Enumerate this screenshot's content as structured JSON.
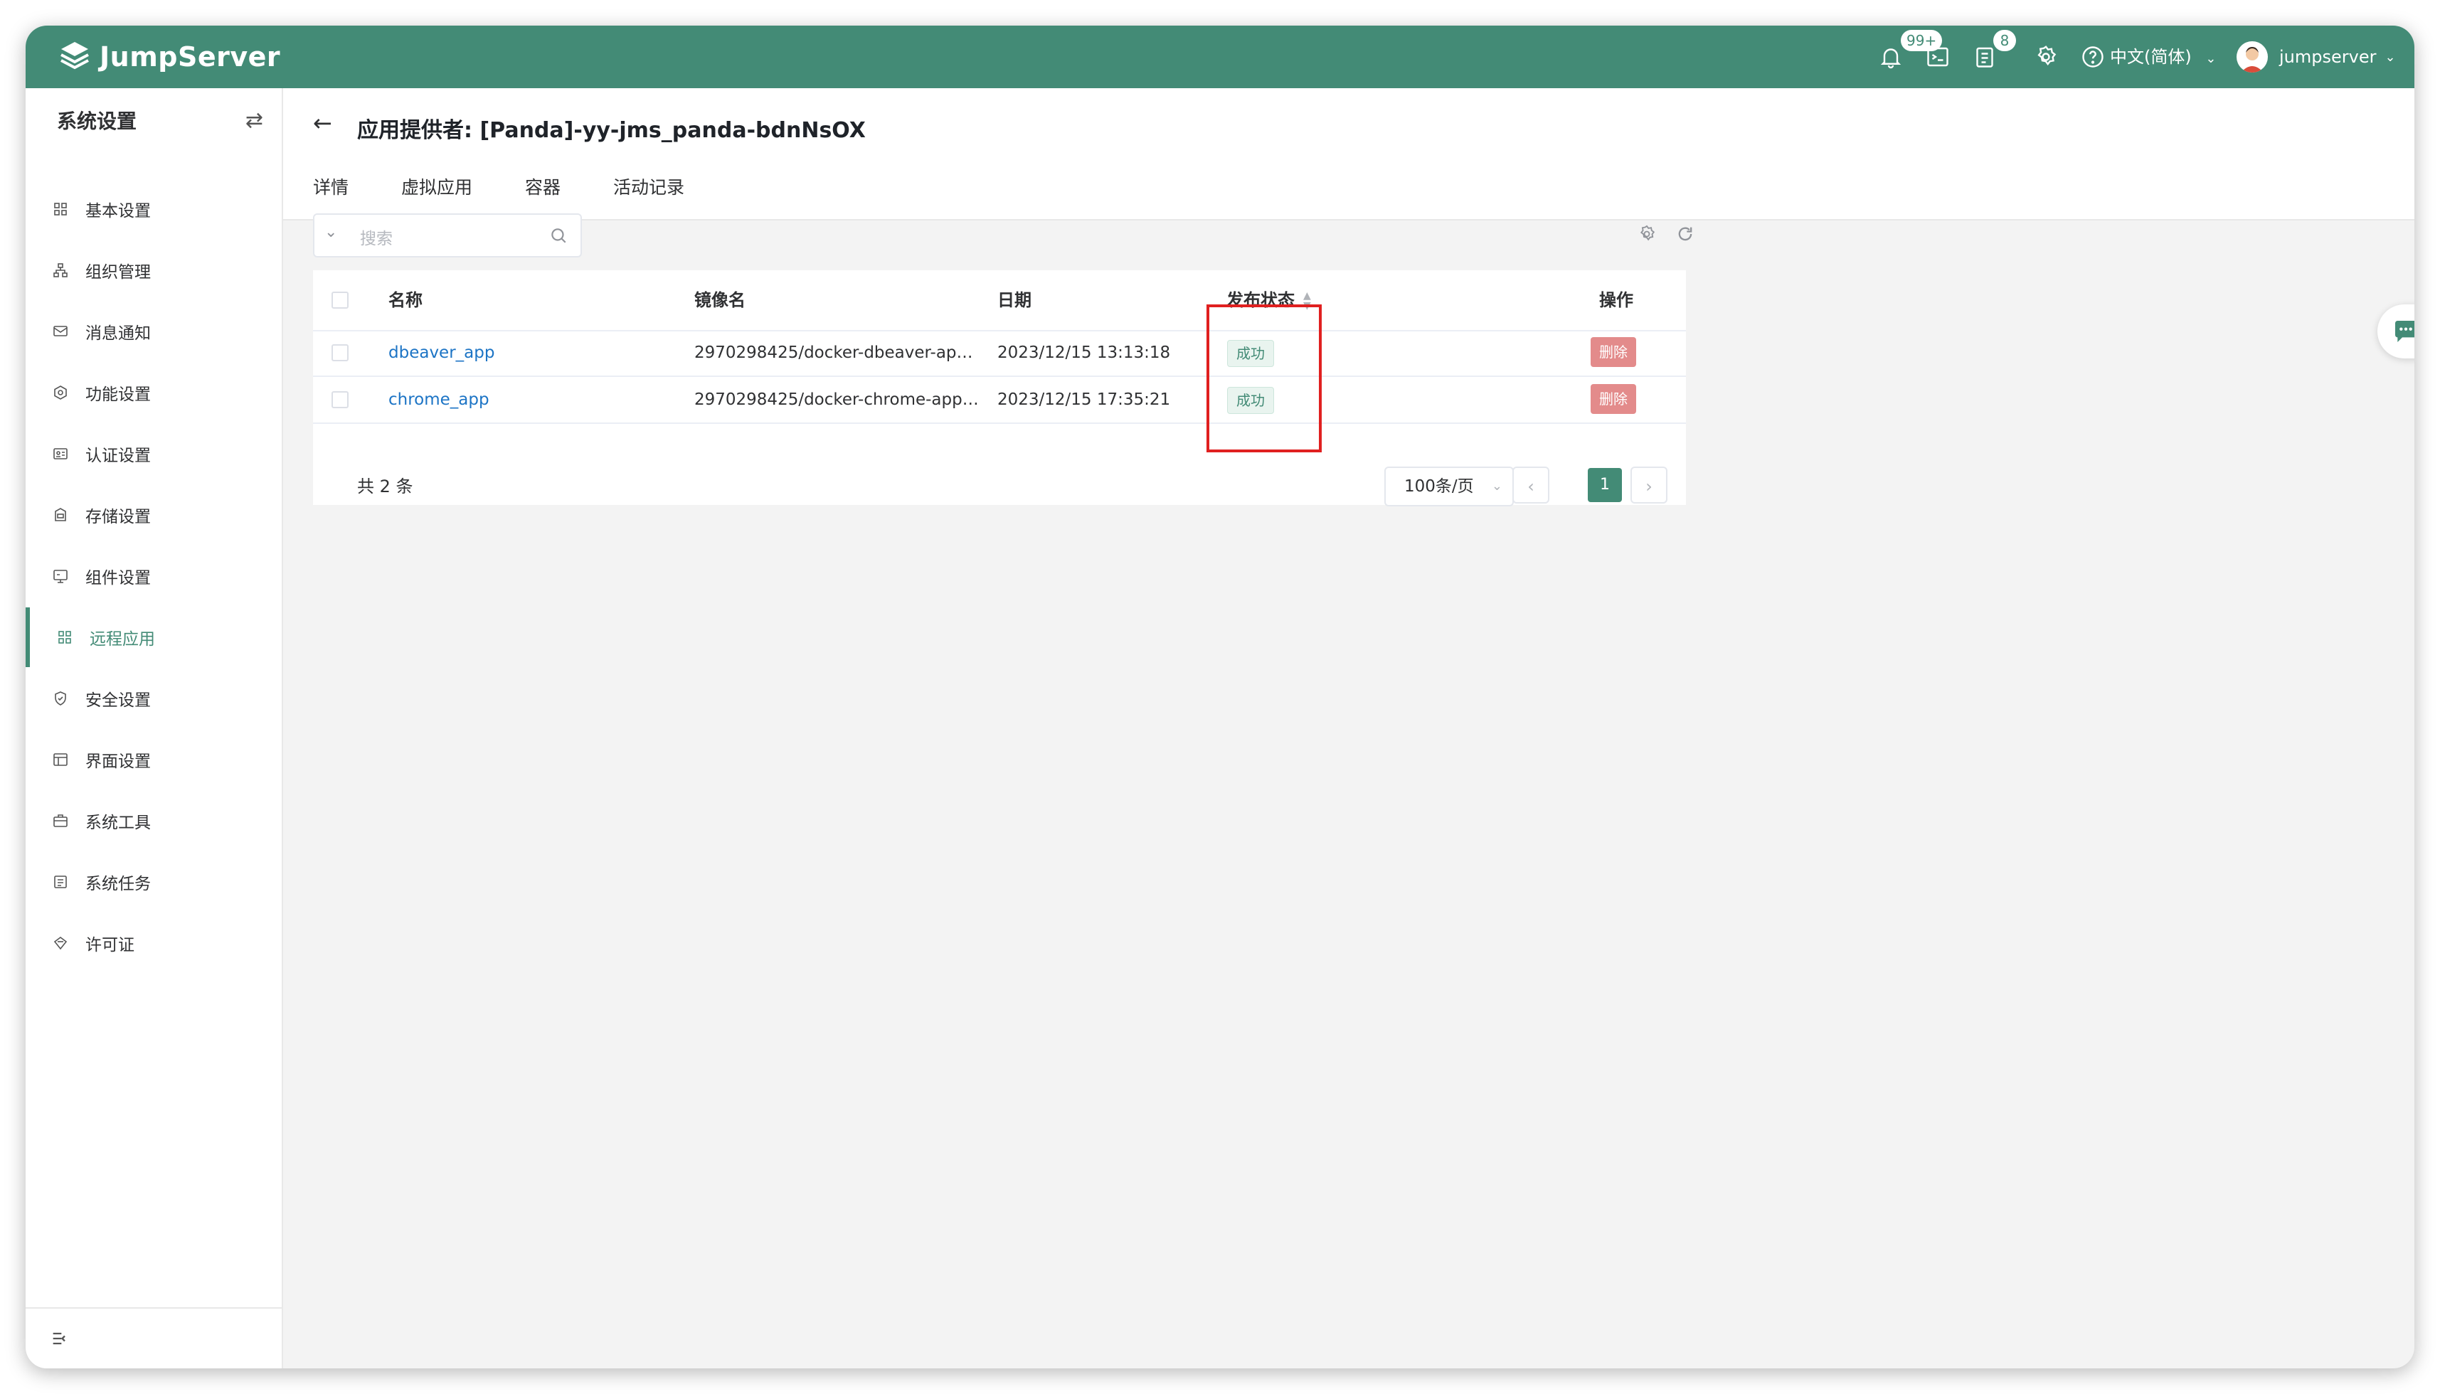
{
  "brand": {
    "name": "JumpServer"
  },
  "topbar": {
    "notification_badge": "99+",
    "task_badge": "8",
    "language": "中文(简体)",
    "username": "jumpserver",
    "icons": [
      "bell-icon",
      "terminal-icon",
      "clipboard-icon",
      "gear-icon",
      "help-icon"
    ]
  },
  "sidebar": {
    "title": "系统设置",
    "items": [
      {
        "label": "基本设置",
        "icon": "grid-icon"
      },
      {
        "label": "组织管理",
        "icon": "org-icon"
      },
      {
        "label": "消息通知",
        "icon": "message-icon"
      },
      {
        "label": "功能设置",
        "icon": "feature-icon"
      },
      {
        "label": "认证设置",
        "icon": "id-card-icon"
      },
      {
        "label": "存储设置",
        "icon": "storage-icon"
      },
      {
        "label": "组件设置",
        "icon": "monitor-icon"
      },
      {
        "label": "远程应用",
        "icon": "apps-icon",
        "active": true
      },
      {
        "label": "安全设置",
        "icon": "shield-icon"
      },
      {
        "label": "界面设置",
        "icon": "layout-icon"
      },
      {
        "label": "系统工具",
        "icon": "toolbox-icon"
      },
      {
        "label": "系统任务",
        "icon": "tasks-icon"
      },
      {
        "label": "许可证",
        "icon": "license-icon"
      }
    ]
  },
  "page": {
    "title": "应用提供者: [Panda]-yy-jms_panda-bdnNsOX",
    "tabs": [
      "详情",
      "虚拟应用",
      "容器",
      "活动记录"
    ],
    "active_tab": "虚拟应用"
  },
  "search": {
    "placeholder": "搜索"
  },
  "table": {
    "headers": {
      "name": "名称",
      "image": "镜像名",
      "date": "日期",
      "status": "发布状态",
      "actions": "操作"
    },
    "rows": [
      {
        "name": "dbeaver_app",
        "image": "2970298425/docker-dbeaver-app:...",
        "date": "2023/12/15 13:13:18",
        "status": "成功",
        "action": "删除"
      },
      {
        "name": "chrome_app",
        "image": "2970298425/docker-chrome-app:...",
        "date": "2023/12/15 17:35:21",
        "status": "成功",
        "action": "删除"
      }
    ]
  },
  "pagination": {
    "total": "共 2 条",
    "page_size": "100条/页",
    "current_page": "1"
  },
  "colors": {
    "brand": "#438b76",
    "link": "#1c74c5",
    "danger": "#e38b8b",
    "highlight": "#e02020"
  }
}
